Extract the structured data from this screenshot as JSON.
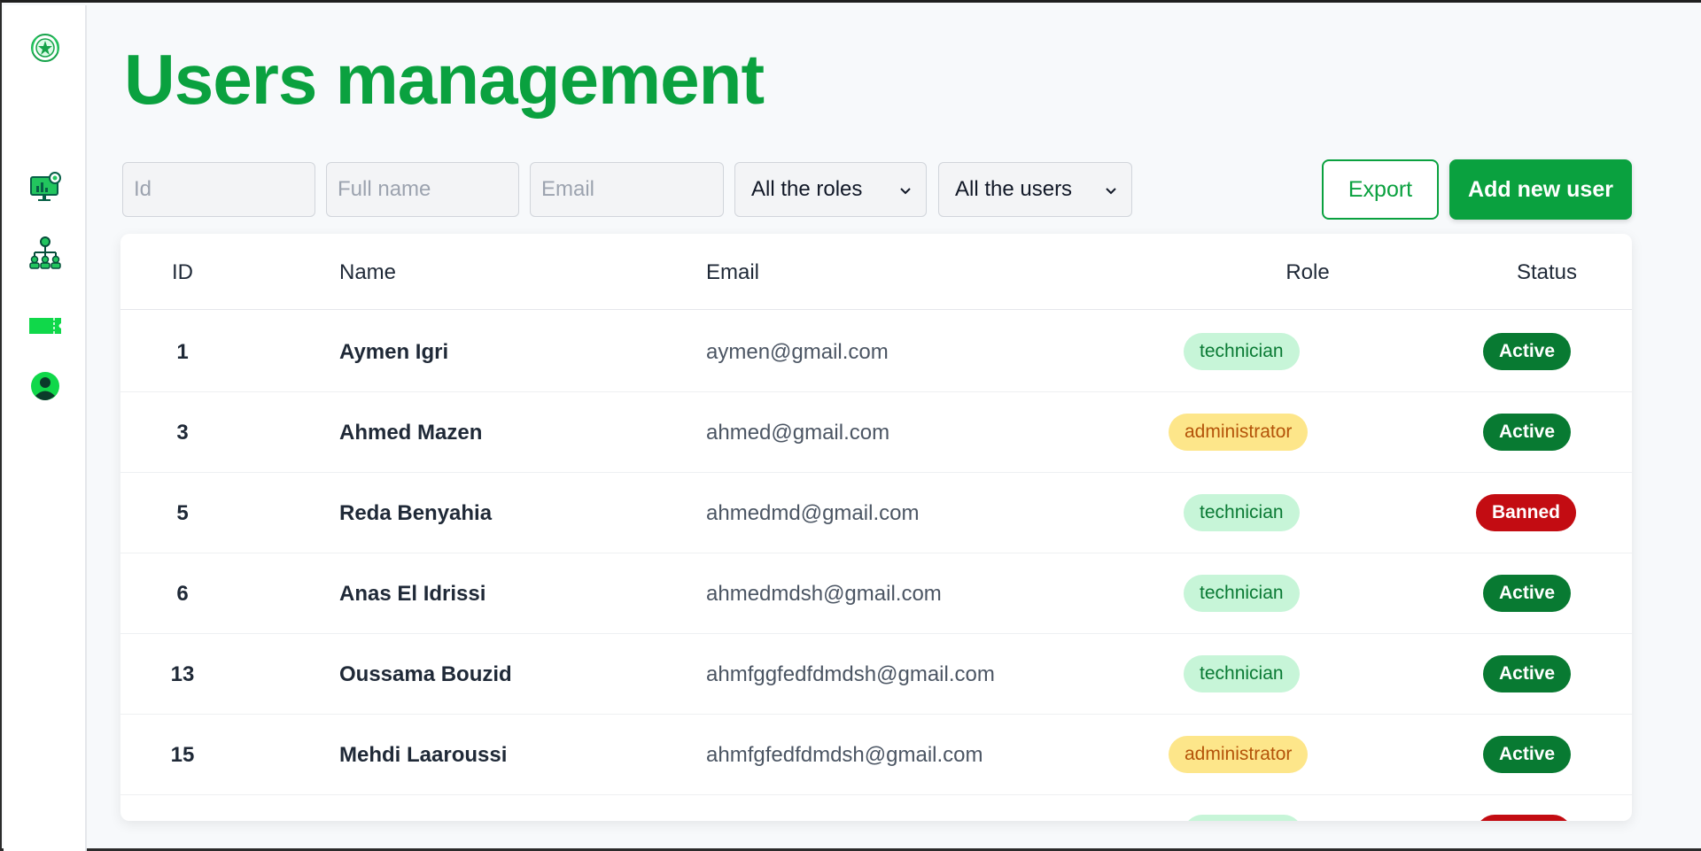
{
  "page": {
    "title": "Users management"
  },
  "filters": {
    "id_placeholder": "Id",
    "name_placeholder": "Full name",
    "email_placeholder": "Email",
    "roles_select": "All the roles",
    "users_select": "All the users"
  },
  "actions": {
    "export_label": "Export",
    "add_label": "Add new user"
  },
  "table": {
    "headers": {
      "id": "ID",
      "name": "Name",
      "email": "Email",
      "role": "Role",
      "status": "Status"
    },
    "rows": [
      {
        "id": "1",
        "name": "Aymen Igri",
        "email": "aymen@gmail.com",
        "role": "technician",
        "status": "Active"
      },
      {
        "id": "3",
        "name": "Ahmed Mazen",
        "email": "ahmed@gmail.com",
        "role": "administrator",
        "status": "Active"
      },
      {
        "id": "5",
        "name": "Reda Benyahia",
        "email": "ahmedmd@gmail.com",
        "role": "technician",
        "status": "Banned"
      },
      {
        "id": "6",
        "name": "Anas El Idrissi",
        "email": "ahmedmdsh@gmail.com",
        "role": "technician",
        "status": "Active"
      },
      {
        "id": "13",
        "name": "Oussama Bouzid",
        "email": "ahmfggfedfdmdsh@gmail.com",
        "role": "technician",
        "status": "Active"
      },
      {
        "id": "15",
        "name": "Mehdi Laaroussi",
        "email": "ahmfgfedfdmdsh@gmail.com",
        "role": "administrator",
        "status": "Active"
      }
    ]
  },
  "sidebar": {
    "items": [
      {
        "icon": "logo-icon"
      },
      {
        "icon": "dashboard-icon"
      },
      {
        "icon": "users-hierarchy-icon"
      },
      {
        "icon": "ticket-icon"
      },
      {
        "icon": "profile-icon"
      }
    ]
  },
  "colors": {
    "brand": "#0aa13f",
    "active": "#087a32",
    "banned": "#c30c12",
    "technician_bg": "#c7f5d8",
    "administrator_bg": "#fde68a"
  }
}
